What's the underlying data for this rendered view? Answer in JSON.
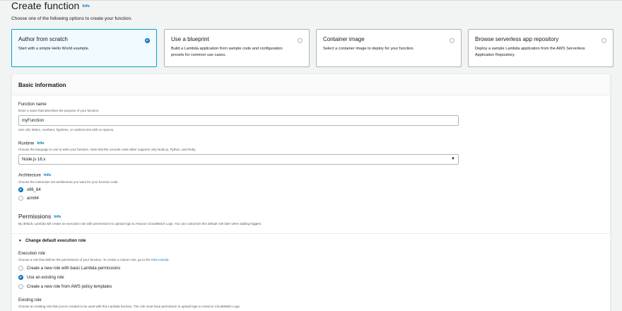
{
  "header": {
    "title": "Create function",
    "info": "Info",
    "subtitle": "Choose one of the following options to create your function."
  },
  "tiles": [
    {
      "title": "Author from scratch",
      "desc": "Start with a simple Hello World example.",
      "selected": true
    },
    {
      "title": "Use a blueprint",
      "desc": "Build a Lambda application from sample code and configuration presets for common use cases.",
      "selected": false
    },
    {
      "title": "Container image",
      "desc": "Select a container image to deploy for your function.",
      "selected": false
    },
    {
      "title": "Browse serverless app repository",
      "desc": "Deploy a sample Lambda application from the AWS Serverless Application Repository.",
      "selected": false
    }
  ],
  "basic": {
    "heading": "Basic information",
    "function_name": {
      "label": "Function name",
      "desc": "Enter a name that describes the purpose of your function.",
      "value": "myFunction",
      "hint": "Use only letters, numbers, hyphens, or underscores with no spaces."
    },
    "runtime": {
      "label": "Runtime",
      "info": "Info",
      "desc": "Choose the language to use to write your function. Note that the console code editor supports only Node.js, Python, and Ruby.",
      "value": "Node.js 16.x",
      "arrow": "▼"
    },
    "architecture": {
      "label": "Architecture",
      "info": "Info",
      "desc": "Choose the instruction set architecture you want for your function code.",
      "options": [
        "x86_64",
        "arm64"
      ],
      "selected": "x86_64"
    }
  },
  "permissions": {
    "title": "Permissions",
    "info": "Info",
    "desc": "By default, Lambda will create an execution role with permissions to upload logs to Amazon CloudWatch Logs. You can customize this default role later when adding triggers.",
    "expander": "Change default execution role",
    "caret": "▼",
    "execution_role": {
      "label": "Execution role",
      "desc": "Choose a role that defines the permissions of your function. To create a custom role, go to the",
      "link": "IAM console",
      "link_suffix": ".",
      "options": [
        "Create a new role with basic Lambda permissions",
        "Use an existing role",
        "Create a new role from AWS policy templates"
      ],
      "selected": "Use an existing role"
    },
    "existing_role": {
      "label": "Existing role",
      "desc": "Choose an existing role that you've created to be used with this Lambda function. The role must have permission to upload logs to Amazon CloudWatch Logs."
    }
  }
}
